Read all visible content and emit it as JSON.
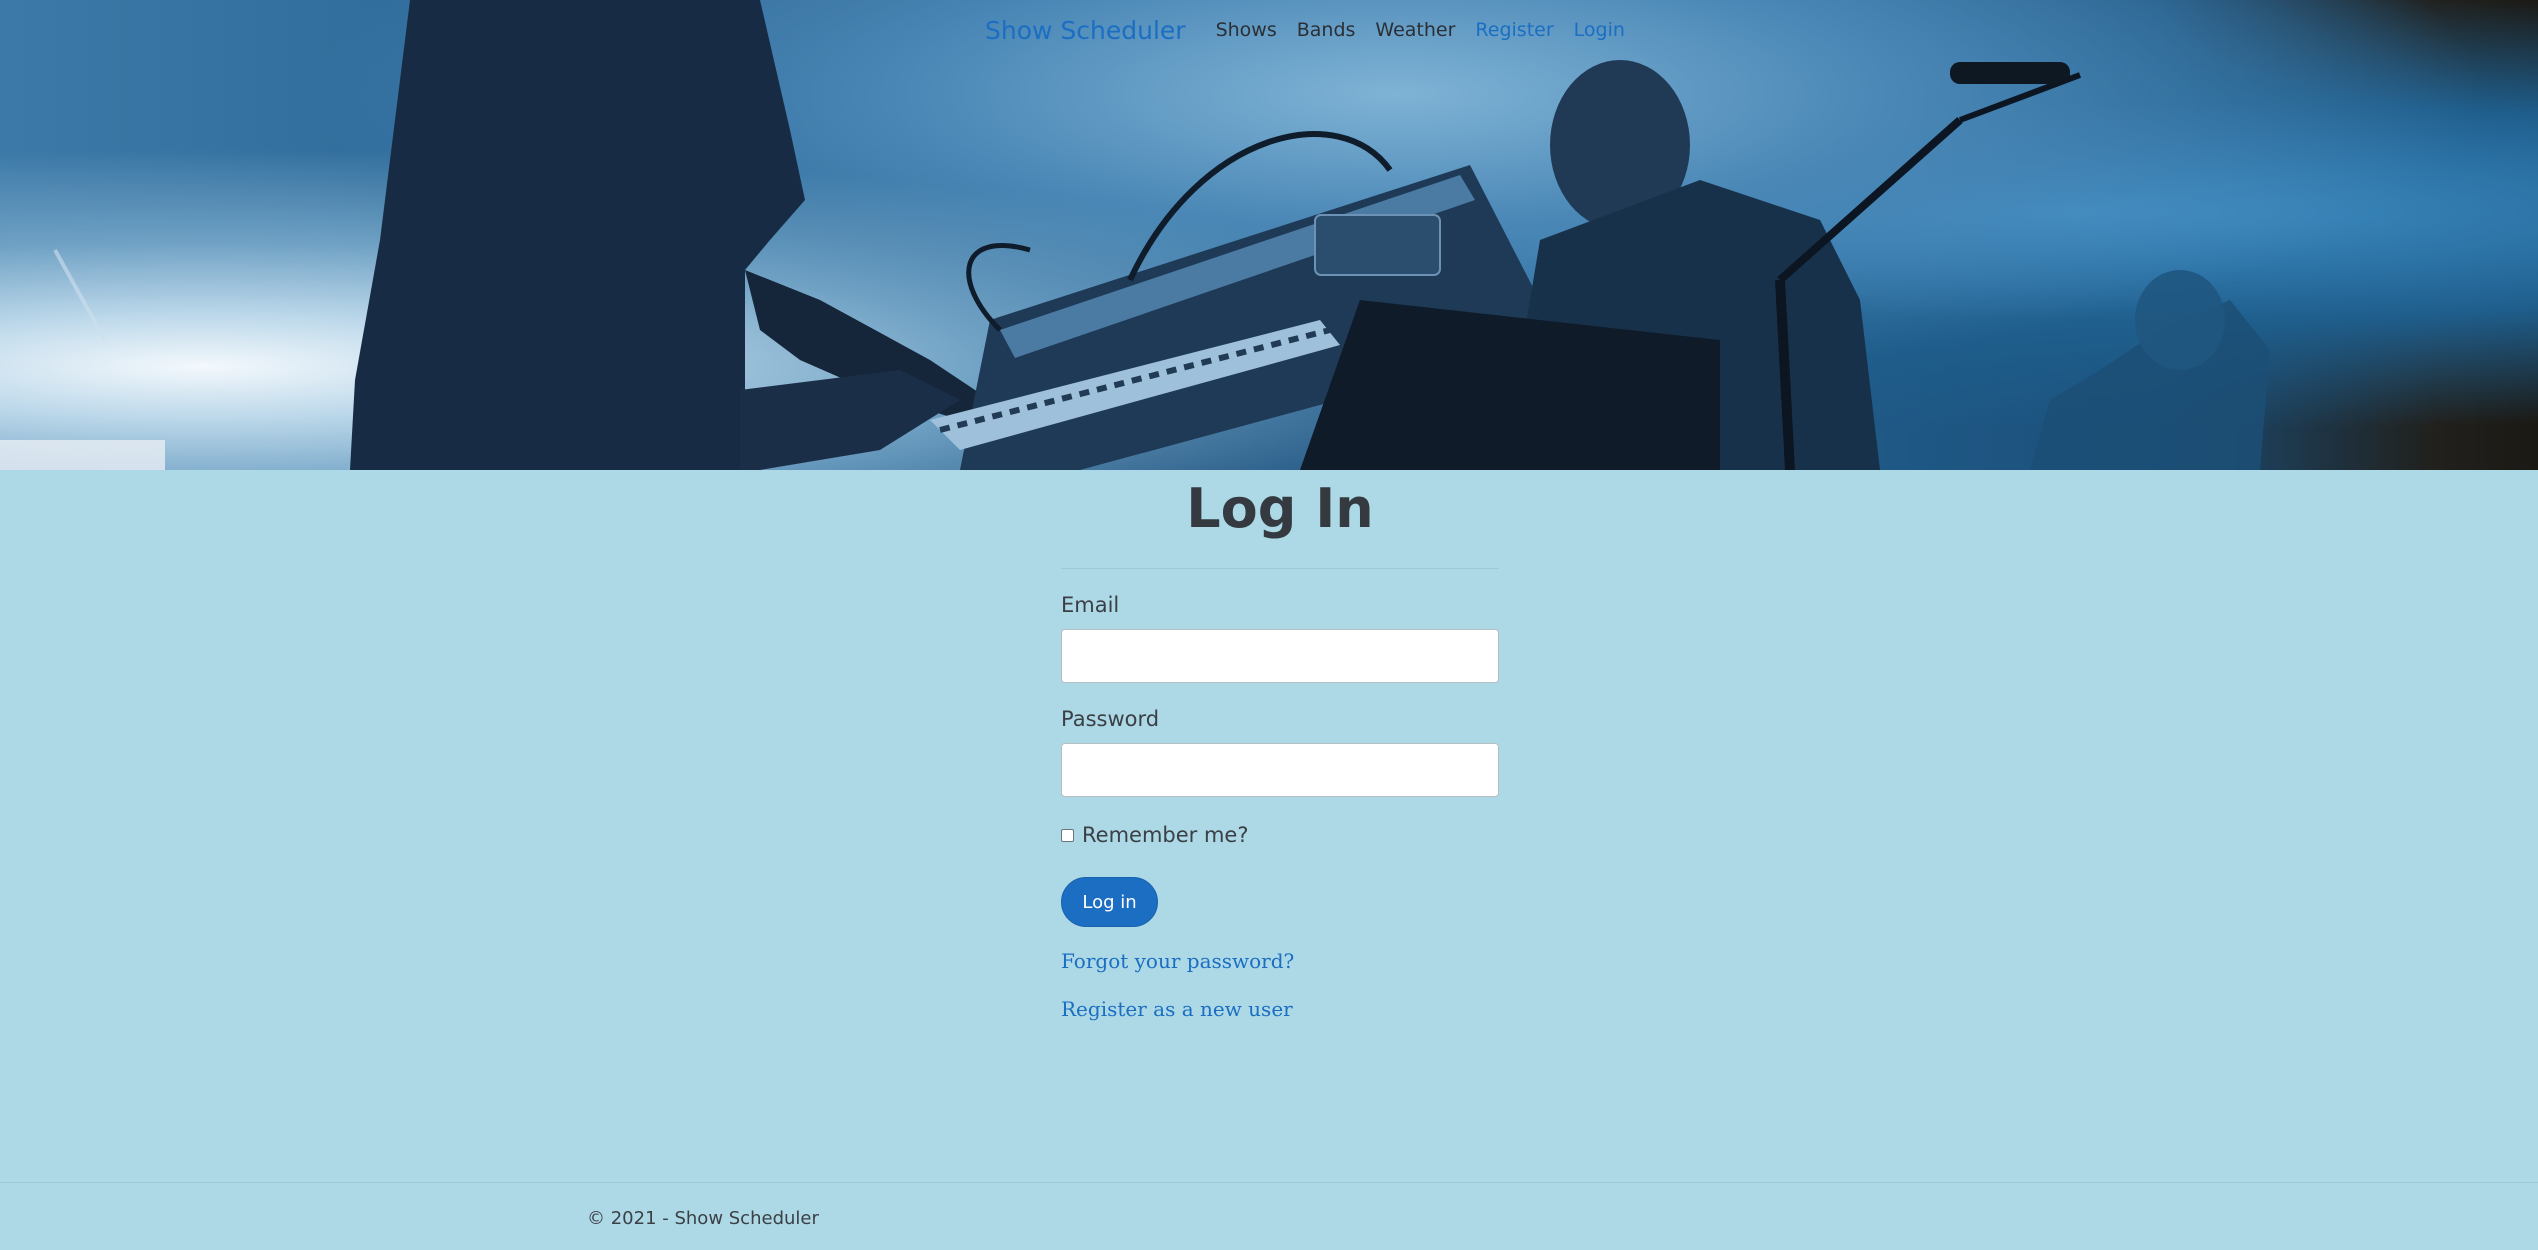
{
  "nav": {
    "brand": "Show Scheduler",
    "links": [
      {
        "label": "Shows"
      },
      {
        "label": "Bands"
      },
      {
        "label": "Weather"
      },
      {
        "label": "Register"
      },
      {
        "label": "Login"
      }
    ]
  },
  "form": {
    "title": "Log In",
    "email_label": "Email",
    "email_value": "",
    "password_label": "Password",
    "password_value": "",
    "remember_label": "Remember me?",
    "remember_checked": false,
    "submit_label": "Log in",
    "forgot_link": "Forgot your password?",
    "register_link": "Register as a new user"
  },
  "footer": {
    "text": "© 2021 - Show Scheduler"
  },
  "colors": {
    "page_background": "#add8e6",
    "accent": "#1b6ec2",
    "heading": "#343a40"
  }
}
